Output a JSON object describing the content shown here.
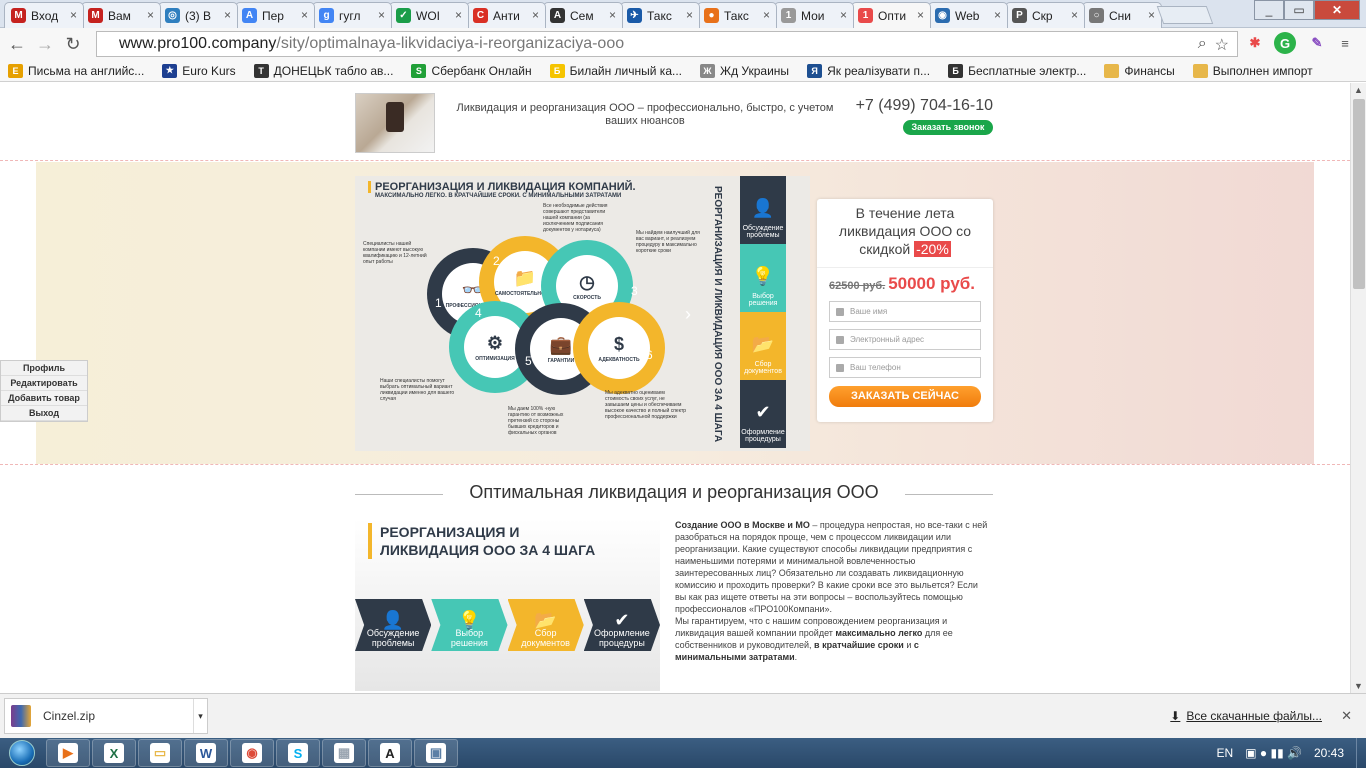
{
  "browser": {
    "tabs": [
      {
        "label": "Вход",
        "color": "#c5221f",
        "glyph": "M"
      },
      {
        "label": "Вам",
        "color": "#c5221f",
        "glyph": "M"
      },
      {
        "label": "(3) В",
        "color": "#2f7fbf",
        "glyph": "◎"
      },
      {
        "label": "Пер",
        "color": "#4285f4",
        "glyph": "A"
      },
      {
        "label": "гугл",
        "color": "#4285f4",
        "glyph": "g"
      },
      {
        "label": "WOI",
        "color": "#1a9d49",
        "glyph": "✓"
      },
      {
        "label": "Анти",
        "color": "#d93025",
        "glyph": "C"
      },
      {
        "label": "Сем",
        "color": "#333333",
        "glyph": "A"
      },
      {
        "label": "Такс",
        "color": "#1a5aa8",
        "glyph": "✈"
      },
      {
        "label": "Такс",
        "color": "#e8711a",
        "glyph": "●"
      },
      {
        "label": "Мои",
        "color": "#999999",
        "glyph": "1"
      },
      {
        "label": "Опти",
        "color": "#e94a4a",
        "glyph": "1"
      },
      {
        "label": "Web",
        "color": "#2b6cb0",
        "glyph": "◉"
      },
      {
        "label": "Скр",
        "color": "#555555",
        "glyph": "P"
      },
      {
        "label": "Сни",
        "color": "#777777",
        "glyph": "○"
      }
    ],
    "url_host": "www.pro100.company",
    "url_path": "/sity/optimalnaya-likvidaciya-i-reorganizaciya-ooo",
    "bookmarks": [
      {
        "label": "Письма на английс...",
        "color": "#e6a000",
        "glyph": "E"
      },
      {
        "label": "Euro Kurs",
        "color": "#1d3f91",
        "glyph": "★"
      },
      {
        "label": "ДОНЕЦЬК табло ав...",
        "color": "#333333",
        "glyph": "Т"
      },
      {
        "label": "Сбербанк Онлайн",
        "color": "#21a038",
        "glyph": "S"
      },
      {
        "label": "Билайн личный ка...",
        "color": "#f5c400",
        "glyph": "Б"
      },
      {
        "label": "Жд Украины",
        "color": "#888888",
        "glyph": "Ж"
      },
      {
        "label": "Як реалізувати п...",
        "color": "#1d4f91",
        "glyph": "Я"
      },
      {
        "label": "Бесплатные электр...",
        "color": "#333333",
        "glyph": "Б"
      },
      {
        "label": "Финансы",
        "color": "#e7b74a",
        "glyph": ""
      },
      {
        "label": "Выполнен импорт",
        "color": "#e7b74a",
        "glyph": ""
      }
    ]
  },
  "site": {
    "tagline": "Ликвидация и реорганизация ООО – профессионально, быстро, с учетом ваших нюансов",
    "phone": "+7 (499) 704-16-10",
    "callback_label": "Заказать звонок"
  },
  "hero": {
    "info_title": "РЕОРГАНИЗАЦИЯ И ЛИКВИДАЦИЯ КОМПАНИЙ.",
    "info_subtitle": "МАКСИМАЛЬНО ЛЕГКО. В КРАТЧАЙШИЕ СРОКИ. С МИНИМАЛЬНЫМИ ЗАТРАТАМИ",
    "vertical_title": "РЕОРГАНИЗАЦИЯ И ЛИКВИДАЦИЯ ООО ЗА 4 ШАГА",
    "circles": [
      {
        "num": "1",
        "label": "ПРОФЕССИОНАЛИЗМ",
        "glyph": "👓",
        "color": "#2f3a48"
      },
      {
        "num": "2",
        "label": "САМОСТОЯТЕЛЬНОСТЬ",
        "glyph": "📁",
        "color": "#f3b62b"
      },
      {
        "num": "3",
        "label": "СКОРОСТЬ",
        "glyph": "◷",
        "color": "#46c7b5"
      },
      {
        "num": "4",
        "label": "ОПТИМИЗАЦИЯ",
        "glyph": "⚙",
        "color": "#46c7b5"
      },
      {
        "num": "5",
        "label": "ГАРАНТИИ",
        "glyph": "💼",
        "color": "#2f3a48"
      },
      {
        "num": "6",
        "label": "АДЕКВАТНОСТЬ",
        "glyph": "$",
        "color": "#f3b62b"
      }
    ],
    "notes": [
      "Специалисты нашей компании имеют высокую квалификацию и 12-летний опыт работы",
      "Все необходимые действия совершают представители нашей компании (за исключением подписания документов у нотариуса)",
      "Мы найдем наилучший для вас вариант, и реализуем процедуру в максимально короткие сроки",
      "Наши специалисты помогут выбрать оптимальный вариант ликвидации именно для вашего случая",
      "Мы даем 100% -ную гарантию от возможных претензий со стороны бывших кредиторов и фискальных органов",
      "Мы адекватно оцениваем стоимость своих услуг, не завышаем цены и обеспечиваем высокое качество и полный спектр профессиональной поддержки"
    ],
    "steps": [
      {
        "label": "Обсуждение проблемы",
        "glyph": "👤",
        "color": "#2f3a48"
      },
      {
        "label": "Выбор решения",
        "glyph": "💡",
        "color": "#46c7b5"
      },
      {
        "label": "Сбор документов",
        "glyph": "📂",
        "color": "#f3b62b"
      },
      {
        "label": "Оформление процедуры",
        "glyph": "✔",
        "color": "#2f3a48"
      }
    ]
  },
  "order": {
    "promo_line1": "В течение лета ликвидация ООО со скидкой",
    "discount": "-20%",
    "old_price": "62500 руб.",
    "new_price": "50000 руб.",
    "name_placeholder": "Ваше имя",
    "email_placeholder": "Электронный адрес",
    "phone_placeholder": "Ваш телефон",
    "submit_label": "ЗАКАЗАТЬ СЕЙЧАС"
  },
  "admin_menu": [
    "Профиль",
    "Редактировать",
    "Добавить товар",
    "Выход"
  ],
  "section": {
    "title": "Оптимальная ликвидация и реорганизация ООО",
    "banner_title_1": "РЕОРГАНИЗАЦИЯ И",
    "banner_title_2": "ЛИКВИДАЦИЯ ООО ЗА 4 ШАГА",
    "banner_steps": [
      {
        "l1": "Обсуждение",
        "l2": "проблемы",
        "glyph": "👤",
        "color": "#2f3a48",
        "tc": "#ffffff"
      },
      {
        "l1": "Выбор",
        "l2": "решения",
        "glyph": "💡",
        "color": "#46c7b5",
        "tc": "#ffffff"
      },
      {
        "l1": "Сбор",
        "l2": "документов",
        "glyph": "📂",
        "color": "#f3b62b",
        "tc": "#ffffff"
      },
      {
        "l1": "Оформление",
        "l2": "процедуры",
        "glyph": "✔",
        "color": "#2f3a48",
        "tc": "#ffffff"
      }
    ],
    "p1_bold": "Создание ООО в Москве и МО",
    "p1_rest": " – процедура непростая, но все-таки с ней разобраться на порядок проще, чем с процессом ликвидации или реорганизации. Какие существуют способы ликвидации предприятия с наименьшими потерями и минимальной вовлеченностью заинтересованных лиц? Обязательно ли создавать ликвидационную комиссию и проходить проверки? В какие сроки все это выльется? Если вы как раз ищете ответы на эти вопросы – воспользуйтесь помощью профессионалов «ПРО100Компани».",
    "p2_a": "Мы гарантируем, что с нашим сопровождением реорганизация и ликвидация вашей компании пройдет ",
    "p2_b1": "максимально легко",
    "p2_c": " для ее собственников и руководителей, ",
    "p2_b2": "в кратчайшие сроки",
    "p2_d": " и ",
    "p2_b3": "с минимальными затратами",
    "p2_e": "."
  },
  "downloads": {
    "file": "Cinzel.zip",
    "all_label": "Все скачанные файлы..."
  },
  "taskbar": {
    "lang": "EN",
    "time": "20:43",
    "apps": [
      {
        "glyph": "▶",
        "color": "#e8711a"
      },
      {
        "glyph": "X",
        "color": "#1e7145"
      },
      {
        "glyph": "▭",
        "color": "#e8b84a"
      },
      {
        "glyph": "W",
        "color": "#2b579a"
      },
      {
        "glyph": "◉",
        "color": "#dd4b39"
      },
      {
        "glyph": "S",
        "color": "#00aff0"
      },
      {
        "glyph": "▦",
        "color": "#9aa5b1"
      },
      {
        "glyph": "A",
        "color": "#222222"
      },
      {
        "glyph": "▣",
        "color": "#5b7fa6"
      }
    ]
  }
}
